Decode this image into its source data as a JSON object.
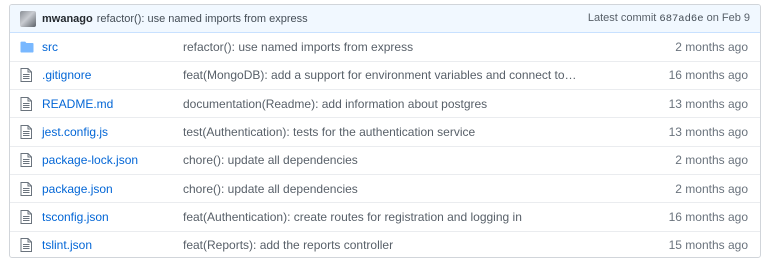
{
  "commit": {
    "author": "mwanago",
    "message": "refactor(): use named imports from express",
    "latest_label": "Latest commit",
    "sha": "687ad6e",
    "date": "on Feb 9"
  },
  "files": [
    {
      "icon": "folder-icon",
      "name": "src",
      "message": "refactor(): use named imports from express",
      "age": "2 months ago"
    },
    {
      "icon": "file-icon",
      "name": ".gitignore",
      "message": "feat(MongoDB): add a support for environment variables and connect to…",
      "age": "16 months ago"
    },
    {
      "icon": "file-icon",
      "name": "README.md",
      "message": "documentation(Readme): add information about postgres",
      "age": "13 months ago"
    },
    {
      "icon": "file-icon",
      "name": "jest.config.js",
      "message": "test(Authentication): tests for the authentication service",
      "age": "13 months ago"
    },
    {
      "icon": "file-icon",
      "name": "package-lock.json",
      "message": "chore(): update all dependencies",
      "age": "2 months ago"
    },
    {
      "icon": "file-icon",
      "name": "package.json",
      "message": "chore(): update all dependencies",
      "age": "2 months ago"
    },
    {
      "icon": "file-icon",
      "name": "tsconfig.json",
      "message": "feat(Authentication): create routes for registration and logging in",
      "age": "16 months ago"
    },
    {
      "icon": "file-icon",
      "name": "tslint.json",
      "message": "feat(Reports): add the reports controller",
      "age": "15 months ago"
    }
  ],
  "colors": {
    "link": "#0366d6",
    "header_bg": "#f1f8ff",
    "icon": "#79b8ff",
    "file_icon": "#6a737d"
  }
}
